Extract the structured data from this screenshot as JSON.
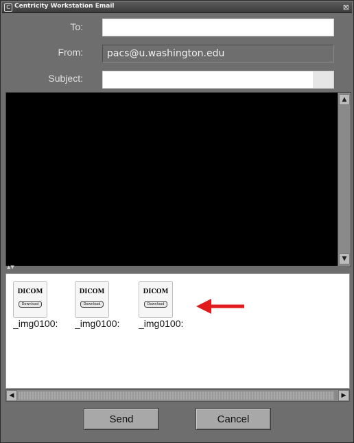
{
  "window": {
    "title": "Centricity Workstation Email",
    "close_glyph": "⊠"
  },
  "form": {
    "to_label": "To:",
    "to_value": "",
    "from_label": "From:",
    "from_value": "pacs@u.washington.edu",
    "subject_label": "Subject:",
    "subject_value": ""
  },
  "attachments": [
    {
      "icon_label": "DICOM",
      "badge": "Download",
      "name": "_img0100:"
    },
    {
      "icon_label": "DICOM",
      "badge": "Download",
      "name": "_img0100:"
    },
    {
      "icon_label": "DICOM",
      "badge": "Download",
      "name": "_img0100:"
    }
  ],
  "annotation": {
    "arrow_color": "#e11b1b"
  },
  "scroll": {
    "up": "▲",
    "down": "▼",
    "left": "◀",
    "right": "▶",
    "splitter": "▲▼"
  },
  "buttons": {
    "send": "Send",
    "cancel": "Cancel"
  },
  "colors": {
    "window_bg": "#6e6e6e",
    "body_bg": "#000000",
    "attach_bg": "#ffffff"
  }
}
